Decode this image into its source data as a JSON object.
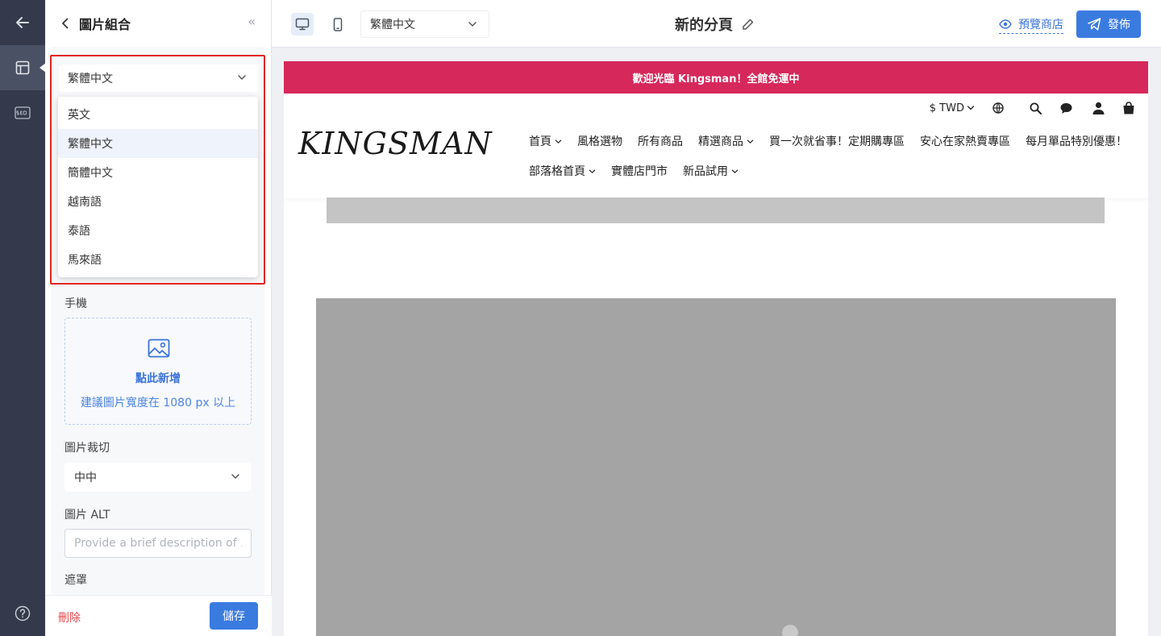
{
  "panel": {
    "title": "圖片組合",
    "collapse_glyph": "«"
  },
  "language_select": {
    "value": "繁體中文",
    "options": [
      "英文",
      "繁體中文",
      "簡體中文",
      "越南語",
      "泰語",
      "馬來語"
    ],
    "selected": "繁體中文"
  },
  "fields": {
    "mobile_label": "手機",
    "upload_primary": "點此新增",
    "upload_hint": "建議圖片寬度在 1080 px 以上",
    "crop_label": "圖片裁切",
    "crop_value": "中中",
    "alt_label": "圖片 ALT",
    "alt_placeholder": "Provide a brief description of ...",
    "mask_label": "遮罩"
  },
  "footer": {
    "delete_label": "刪除",
    "save_label": "儲存"
  },
  "topbar": {
    "language": "繁體中文",
    "page_title": "新的分頁",
    "preview_label": "預覽商店",
    "publish_label": "發佈"
  },
  "store": {
    "announcement": "歡迎光臨 Kingsman！全館免運中",
    "currency": "$ TWD",
    "logo": "KINGSMAN",
    "nav_row1": [
      {
        "label": "首頁",
        "dropdown": true
      },
      {
        "label": "風格選物",
        "dropdown": false
      },
      {
        "label": "所有商品",
        "dropdown": false
      },
      {
        "label": "精選商品",
        "dropdown": true
      },
      {
        "label": "買一次就省事！定期購專區",
        "dropdown": false
      },
      {
        "label": "安心在家熱賣專區",
        "dropdown": false
      },
      {
        "label": "每月單品特別優惠！",
        "dropdown": false
      }
    ],
    "nav_row2": [
      {
        "label": "部落格首頁",
        "dropdown": true
      },
      {
        "label": "實體店門市",
        "dropdown": false
      },
      {
        "label": "新品試用",
        "dropdown": true
      }
    ]
  },
  "colors": {
    "rail": "#343a4b",
    "accent": "#3a7be0",
    "announcement": "#d6285a",
    "highlight": "#e0251f",
    "danger": "#e5484d"
  },
  "icons": {
    "rail": [
      "back-arrow-icon",
      "layout-icon",
      "seo-icon",
      "help-icon"
    ],
    "topbar": [
      "desktop-icon",
      "mobile-icon",
      "chevron-down-icon",
      "pencil-icon",
      "eye-icon",
      "send-icon"
    ],
    "store": [
      "globe-icon",
      "search-icon",
      "chat-icon",
      "user-icon",
      "bag-icon"
    ]
  }
}
